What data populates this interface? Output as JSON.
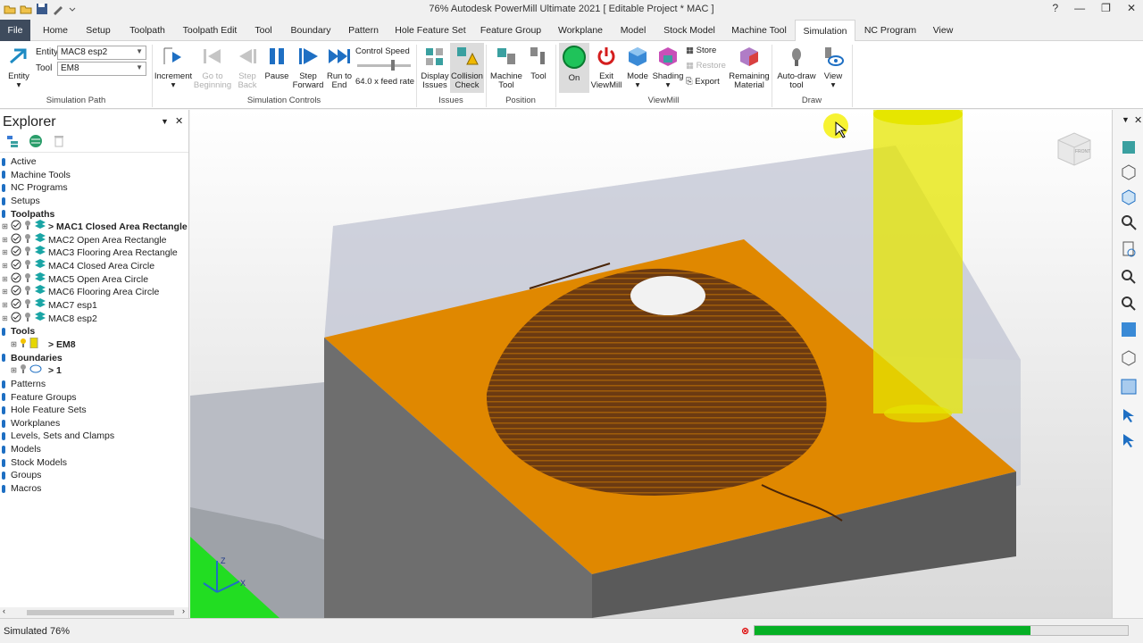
{
  "window": {
    "title": "76% Autodesk PowerMill Ultimate 2021    [ Editable Project * MAC ]",
    "help_glyph": "?",
    "min_glyph": "—",
    "restore_glyph": "❐",
    "close_glyph": "✕"
  },
  "tabs": [
    "File",
    "Home",
    "Setup",
    "Toolpath",
    "Toolpath Edit",
    "Tool",
    "Boundary",
    "Pattern",
    "Hole Feature Set",
    "Feature Group",
    "Workplane",
    "Model",
    "Stock Model",
    "Machine Tool",
    "Simulation",
    "NC Program",
    "View"
  ],
  "ribbon": {
    "simulation_path": {
      "entity_btn": "Entity",
      "entity_label": "Entity",
      "entity_value": "MAC8 esp2",
      "tool_label": "Tool",
      "tool_value": "EM8",
      "group": "Simulation Path"
    },
    "controls": {
      "increment": "Increment",
      "go_to_beginning": "Go to Beginning",
      "step_back": "Step Back",
      "pause": "Pause",
      "step_forward": "Step Forward",
      "run_to_end": "Run to End",
      "control_speed": "Control Speed",
      "feed_rate": "64.0 x feed rate",
      "group": "Simulation Controls"
    },
    "issues": {
      "display_issues": "Display Issues",
      "collision_check": "Collision Check",
      "group": "Issues"
    },
    "position": {
      "machine_tool": "Machine Tool",
      "tool": "Tool",
      "group": "Position"
    },
    "viewmill": {
      "on": "On",
      "exit": "Exit ViewMill",
      "mode": "Mode",
      "shading": "Shading",
      "store": "Store",
      "restore": "Restore",
      "export": "Export",
      "remaining": "Remaining Material",
      "group": "ViewMill"
    },
    "draw": {
      "auto_draw": "Auto-draw tool",
      "view": "View",
      "group": "Draw"
    }
  },
  "explorer": {
    "title": "Explorer",
    "items": [
      {
        "label": "Active",
        "bold": false,
        "child": false
      },
      {
        "label": "Machine Tools",
        "bold": false,
        "child": false
      },
      {
        "label": "NC Programs",
        "bold": false,
        "child": false
      },
      {
        "label": "Setups",
        "bold": false,
        "child": false
      },
      {
        "label": "Toolpaths",
        "bold": true,
        "child": false
      },
      {
        "label": "> MAC1 Closed Area Rectangle",
        "bold": true,
        "child": true,
        "kind": "toolpath"
      },
      {
        "label": "MAC2 Open Area Rectangle",
        "bold": false,
        "child": true,
        "kind": "toolpath"
      },
      {
        "label": "MAC3 Flooring Area Rectangle",
        "bold": false,
        "child": true,
        "kind": "toolpath"
      },
      {
        "label": "MAC4 Closed Area Circle",
        "bold": false,
        "child": true,
        "kind": "toolpath"
      },
      {
        "label": "MAC5 Open Area Circle",
        "bold": false,
        "child": true,
        "kind": "toolpath"
      },
      {
        "label": "MAC6 Flooring Area Circle",
        "bold": false,
        "child": true,
        "kind": "toolpath"
      },
      {
        "label": "MAC7 esp1",
        "bold": false,
        "child": true,
        "kind": "toolpath"
      },
      {
        "label": "MAC8 esp2",
        "bold": false,
        "child": true,
        "kind": "toolpath"
      },
      {
        "label": "Tools",
        "bold": true,
        "child": false
      },
      {
        "label": "> EM8",
        "bold": true,
        "child": true,
        "kind": "tool"
      },
      {
        "label": "Boundaries",
        "bold": true,
        "child": false
      },
      {
        "label": "> 1",
        "bold": true,
        "child": true,
        "kind": "boundary"
      },
      {
        "label": "Patterns",
        "bold": false,
        "child": false
      },
      {
        "label": "Feature Groups",
        "bold": false,
        "child": false
      },
      {
        "label": "Hole Feature Sets",
        "bold": false,
        "child": false
      },
      {
        "label": "Workplanes",
        "bold": false,
        "child": false
      },
      {
        "label": "Levels, Sets and Clamps",
        "bold": false,
        "child": false
      },
      {
        "label": "Models",
        "bold": false,
        "child": false
      },
      {
        "label": "Stock Models",
        "bold": false,
        "child": false
      },
      {
        "label": "Groups",
        "bold": false,
        "child": false
      },
      {
        "label": "Macros",
        "bold": false,
        "child": false
      }
    ]
  },
  "viewport": {
    "viewcube_label": "FRONT",
    "axis_z": "Z",
    "axis_x": "X",
    "stock_color": "#e08800",
    "dome_color": "#6b3a12",
    "tool_color": "#e6e600"
  },
  "status": {
    "text": "Simulated 76%",
    "progress": 0.74,
    "progress_color": "#06b025",
    "cancel_glyph": "⊗"
  }
}
